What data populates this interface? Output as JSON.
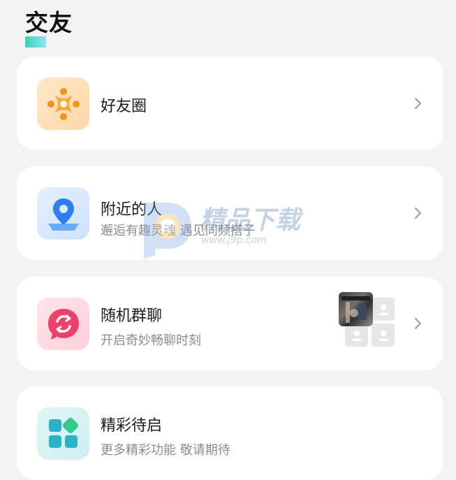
{
  "header": {
    "title": "交友"
  },
  "cards": [
    {
      "title": "好友圈",
      "subtitle": "",
      "icon": "friends-circle-icon",
      "color": "#f79a2a"
    },
    {
      "title": "附近的人",
      "subtitle": "邂逅有趣灵魂 遇见同频搭子",
      "icon": "location-pin-icon",
      "color": "#2d7ff0"
    },
    {
      "title": "随机群聊",
      "subtitle": "开启奇妙畅聊时刻",
      "icon": "random-chat-icon",
      "color": "#f0406a"
    },
    {
      "title": "精彩待启",
      "subtitle": "更多精彩功能 敬请期待",
      "icon": "apps-grid-icon",
      "color": "#2ab3c6"
    }
  ],
  "watermark": {
    "text": "精品下载",
    "url": "www.j9p.com"
  },
  "colors": {
    "accent_teal": "#1ec9a8",
    "background": "#f3f3f3"
  }
}
